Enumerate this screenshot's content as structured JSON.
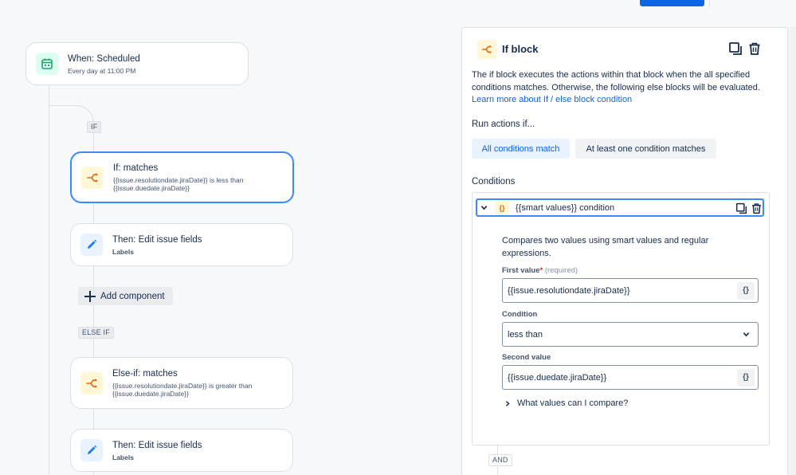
{
  "flow": {
    "trigger": {
      "title": "When: Scheduled",
      "subtitle": "Every day at 11:00 PM"
    },
    "if_label": "IF",
    "if_card": {
      "title": "If: matches",
      "subtitle_line1": "{{issue.resolutiondate.jiraDate}} is less than",
      "subtitle_line2": "{{issue.duedate.jiraDate}}"
    },
    "then_card_1": {
      "title": "Then: Edit issue fields",
      "subtitle": "Labels"
    },
    "add_component_label": "Add component",
    "else_if_label": "ELSE IF",
    "else_if_card": {
      "title": "Else-if: matches",
      "subtitle_line1": "{{issue.resolutiondate.jiraDate}} is greater than",
      "subtitle_line2": "{{issue.duedate.jiraDate}}"
    },
    "then_card_2": {
      "title": "Then: Edit issue fields",
      "subtitle": "Labels"
    }
  },
  "panel": {
    "title": "If block",
    "description": "The if block executes the actions within that block when the all specified conditions matches. Otherwise, the following else blocks will be evaluated.",
    "learn_more": "Learn more about If / else block condition",
    "run_actions_label": "Run actions if...",
    "options": {
      "all": "All conditions match",
      "any": "At least one condition matches"
    },
    "conditions_label": "Conditions",
    "condition": {
      "title": "{{smart values}} condition",
      "icon_text": "{}",
      "description": "Compares two values using smart values and regular expressions.",
      "first_value_label": "First value",
      "required_star": "*",
      "required_hint": "(required)",
      "first_value": "{{issue.resolutiondate.jiraDate}}",
      "condition_label": "Condition",
      "condition_value": "less than",
      "second_value_label": "Second value",
      "second_value": "{{issue.duedate.jiraDate}}",
      "smart_value_button": "{}",
      "what_values": "What values can I compare?"
    },
    "and_label": "AND"
  },
  "colors": {
    "accent": "#0c66e4",
    "selected_border": "#388bff",
    "condition_icon_bg": "#fff7d6",
    "condition_icon": "#e56910",
    "edit_icon_bg": "#e9f2ff",
    "schedule_icon_bg": "#dcfff1"
  }
}
